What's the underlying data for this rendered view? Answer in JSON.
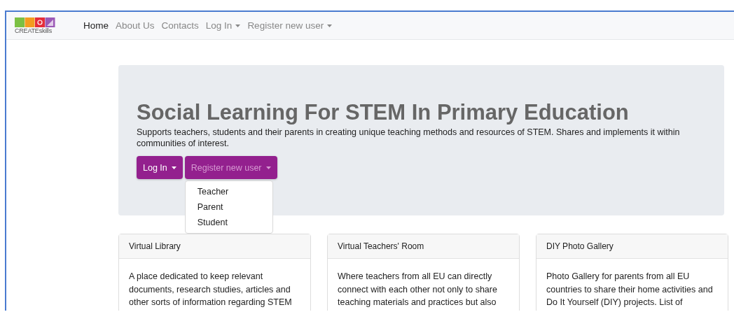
{
  "logo": {
    "text": "CREATEskills"
  },
  "nav": [
    {
      "label": "Home",
      "selected": true,
      "dropdown": false
    },
    {
      "label": "About Us",
      "selected": false,
      "dropdown": false
    },
    {
      "label": "Contacts",
      "selected": false,
      "dropdown": false
    },
    {
      "label": "Log In",
      "selected": false,
      "dropdown": true
    },
    {
      "label": "Register new user",
      "selected": false,
      "dropdown": true
    }
  ],
  "hero": {
    "title": "Social Learning For STEM In Primary Education",
    "lead": "Supports teachers, students and their parents in creating unique teaching methods and resources of STEM. Shares and implements it within communities of interest.",
    "buttons": [
      {
        "label": "Log In",
        "expanded": false
      },
      {
        "label": "Register new user",
        "expanded": true,
        "menu": [
          "Teacher",
          "Parent",
          "Student"
        ]
      }
    ]
  },
  "cards": [
    {
      "title": "Virtual Library",
      "text": "A place dedicated to keep relevant documents, research studies, articles and other sorts of information regarding STEM"
    },
    {
      "title": "Virtual Teachers' Room",
      "text": "Where teachers from all EU can directly connect with each other not only to share teaching materials and practices but also"
    },
    {
      "title": "DIY Photo Gallery",
      "text": "Photo Gallery for parents from all EU countries to share their home activities and Do It Yourself (DIY) projects. List of"
    }
  ]
}
